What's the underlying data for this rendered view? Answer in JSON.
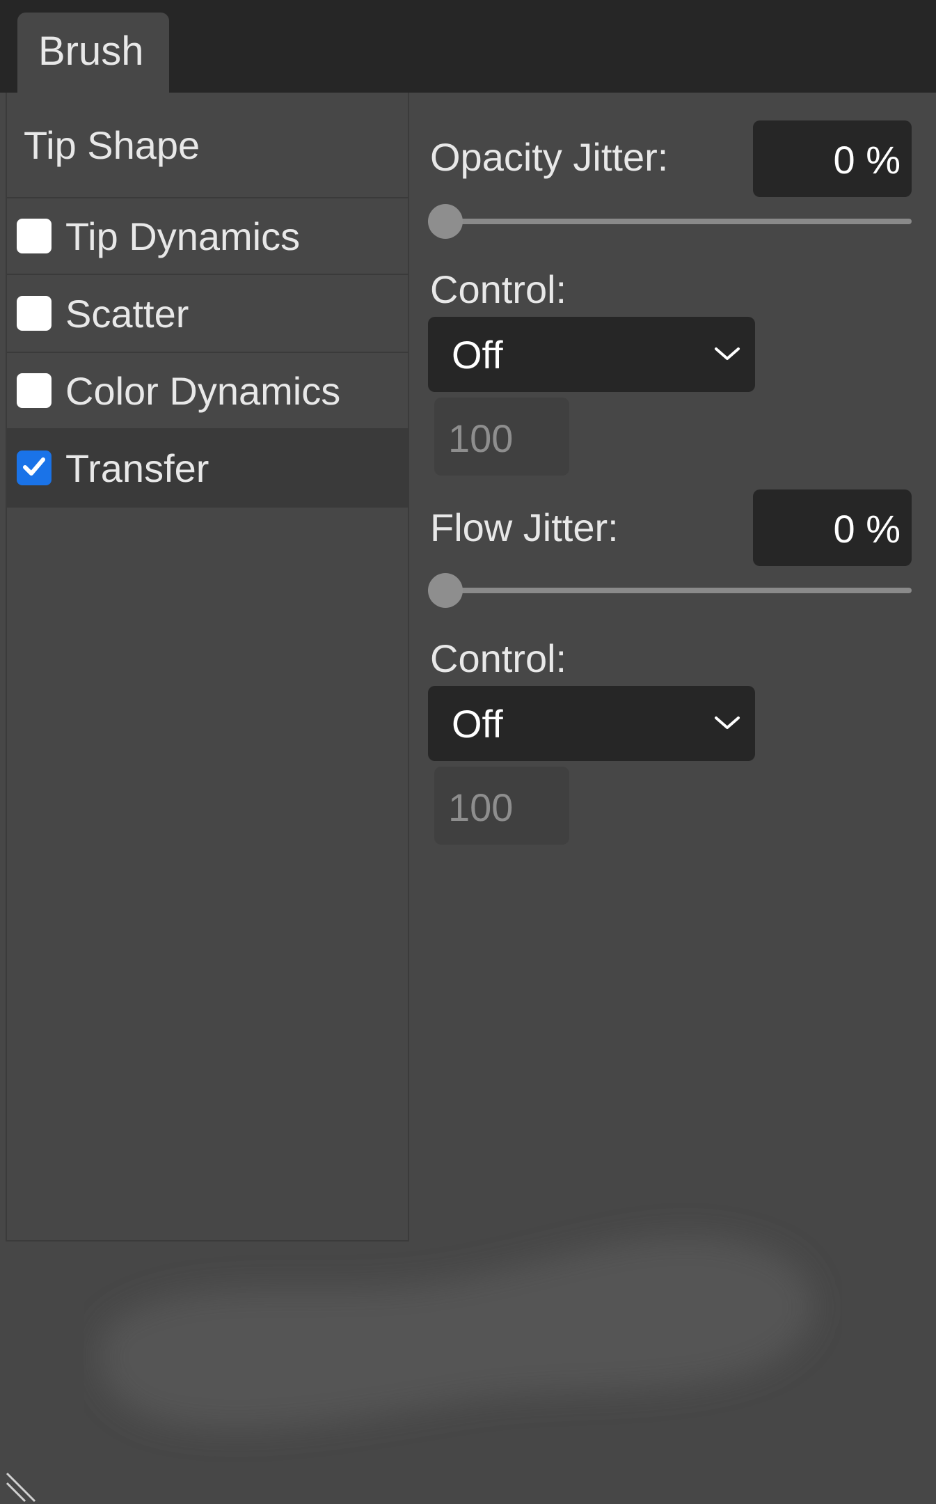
{
  "tab": {
    "label": "Brush"
  },
  "sidebar": {
    "items": [
      {
        "label": "Tip Shape",
        "has_checkbox": false,
        "checked": false,
        "active": false
      },
      {
        "label": "Tip Dynamics",
        "has_checkbox": true,
        "checked": false,
        "active": false
      },
      {
        "label": "Scatter",
        "has_checkbox": true,
        "checked": false,
        "active": false
      },
      {
        "label": "Color Dynamics",
        "has_checkbox": true,
        "checked": false,
        "active": false
      },
      {
        "label": "Transfer",
        "has_checkbox": true,
        "checked": true,
        "active": true
      }
    ]
  },
  "opacity": {
    "label": "Opacity Jitter:",
    "value": "0 %",
    "slider_fraction": 0,
    "control_label": "Control:",
    "control_value": "Off",
    "control_number": "100"
  },
  "flow": {
    "label": "Flow Jitter:",
    "value": "0 %",
    "slider_fraction": 0,
    "control_label": "Control:",
    "control_value": "Off",
    "control_number": "100"
  },
  "colors": {
    "accent": "#1a73e8",
    "panel": "#474747",
    "field": "#262626"
  }
}
